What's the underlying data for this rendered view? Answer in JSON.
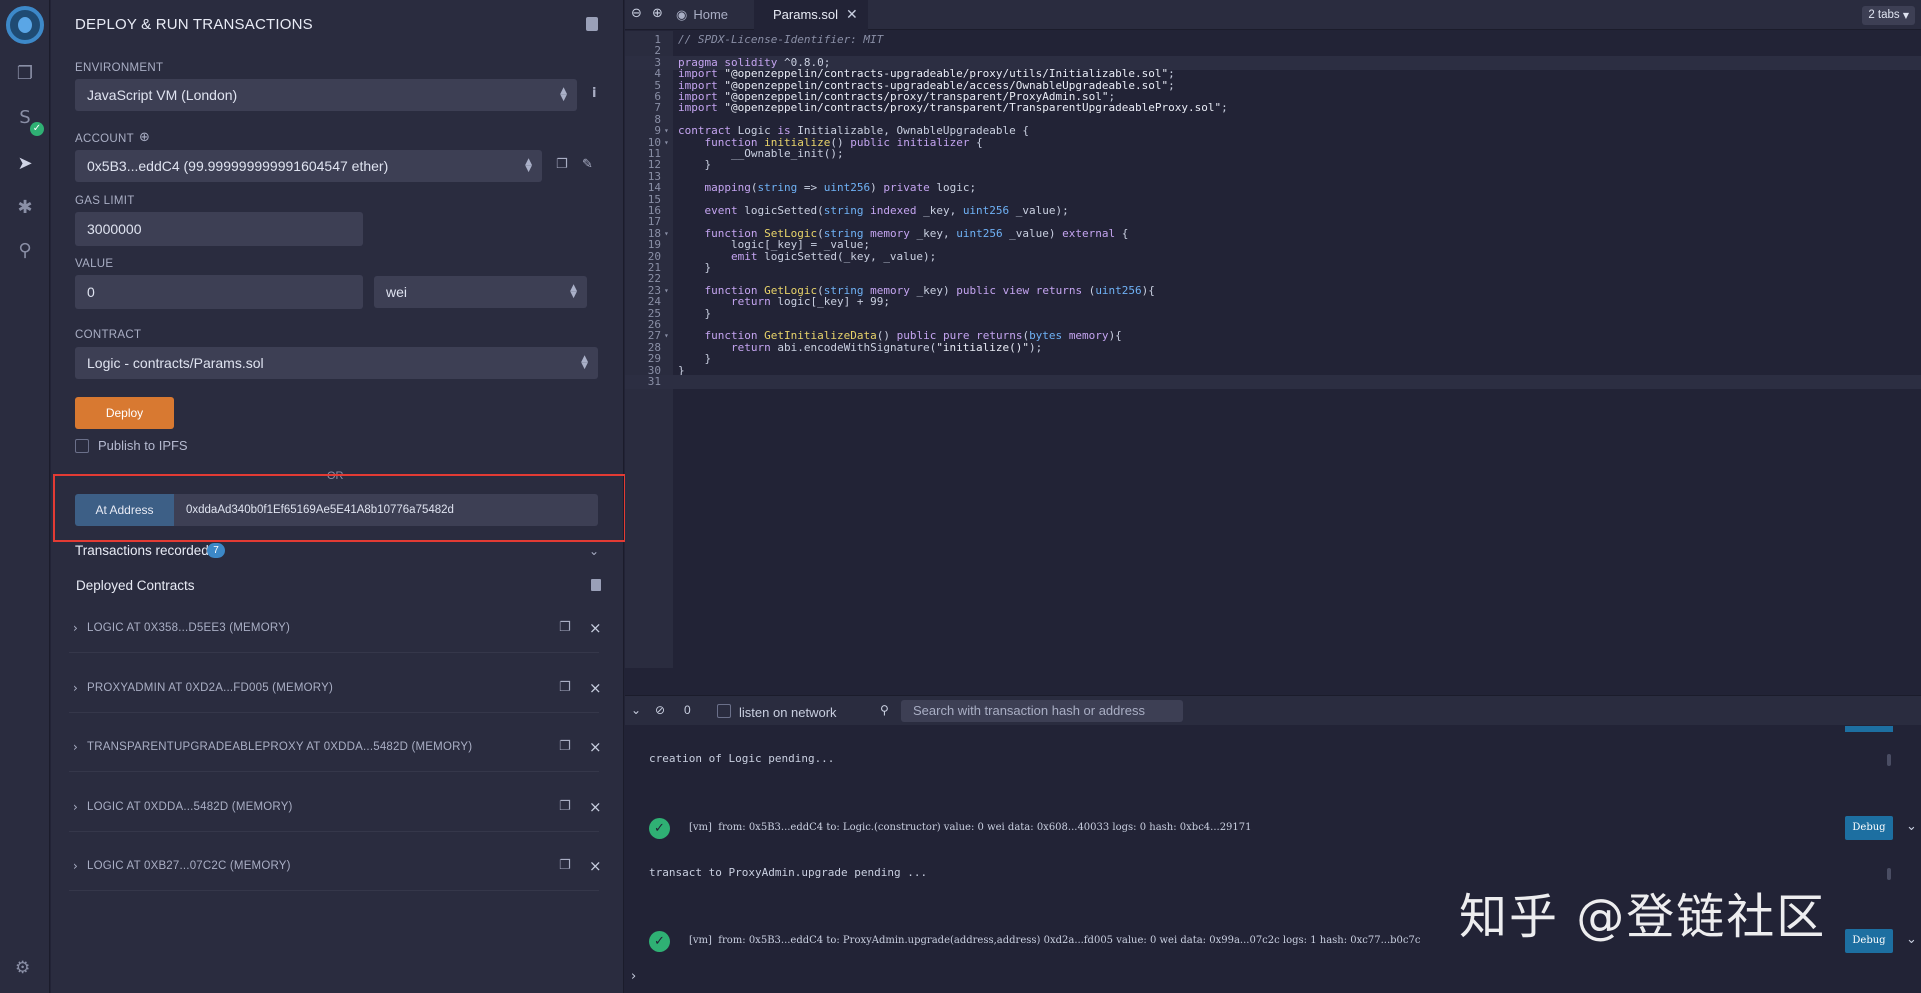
{
  "panel": {
    "title": "DEPLOY & RUN TRANSACTIONS",
    "environment_label": "ENVIRONMENT",
    "environment_value": "JavaScript VM (London)",
    "account_label": "ACCOUNT",
    "account_value": "0x5B3...eddC4 (99.999999999991604547 ether)",
    "gas_limit_label": "GAS LIMIT",
    "gas_limit_value": "3000000",
    "value_label": "VALUE",
    "value_amount": "0",
    "value_unit": "wei",
    "contract_label": "CONTRACT",
    "contract_value": "Logic - contracts/Params.sol",
    "deploy_label": "Deploy",
    "publish_label": "Publish to IPFS",
    "or_label": "OR",
    "at_address_label": "At Address",
    "at_address_value": "0xddaAd340b0f1Ef65169Ae5E41A8b10776a75482d",
    "transactions_recorded_label": "Transactions recorded",
    "transactions_recorded_count": "7",
    "deployed_contracts_label": "Deployed Contracts",
    "deployed_contracts": [
      {
        "name": "LOGIC AT 0X358...D5EE3 (MEMORY)"
      },
      {
        "name": "PROXYADMIN AT 0XD2A...FD005 (MEMORY)"
      },
      {
        "name": "TRANSPARENTUPGRADEABLEPROXY AT 0XDDA...5482D (MEMORY)"
      },
      {
        "name": "LOGIC AT 0XDDA...5482D (MEMORY)"
      },
      {
        "name": "LOGIC AT 0XB27...07C2C (MEMORY)"
      }
    ]
  },
  "tabs": {
    "home_label": "Home",
    "file_label": "Params.sol",
    "count_label": "2 tabs"
  },
  "terminal": {
    "count": "0",
    "listen_label": "listen on network",
    "search_placeholder": "Search with transaction hash or address",
    "line1": "creation of Logic pending...",
    "log1": "[vm]  from: 0x5B3...eddC4 to: Logic.(constructor) value: 0 wei data: 0x608...40033 logs: 0 hash: 0xbc4...29171",
    "line2": "transact to ProxyAdmin.upgrade pending ...",
    "log2": "[vm]  from: 0x5B3...eddC4 to: ProxyAdmin.upgrade(address,address) 0xd2a...fd005 value: 0 wei data: 0x99a...07c2c logs: 1 hash: 0xc77...b0c7c",
    "debug_label": "Debug"
  },
  "watermark": "知乎 @登链社区",
  "code_lines": [
    "// SPDX-License-Identifier: MIT",
    "",
    "pragma solidity ^0.8.0;",
    "import \"@openzeppelin/contracts-upgradeable/proxy/utils/Initializable.sol\";",
    "import \"@openzeppelin/contracts-upgradeable/access/OwnableUpgradeable.sol\";",
    "import \"@openzeppelin/contracts/proxy/transparent/ProxyAdmin.sol\";",
    "import \"@openzeppelin/contracts/proxy/transparent/TransparentUpgradeableProxy.sol\";",
    "",
    "contract Logic is Initializable, OwnableUpgradeable {",
    "    function initialize() public initializer {",
    "        __Ownable_init();",
    "    }",
    "",
    "    mapping(string => uint256) private logic;",
    "",
    "    event logicSetted(string indexed _key, uint256 _value);",
    "",
    "    function SetLogic(string memory _key, uint256 _value) external {",
    "        logic[_key] = _value;",
    "        emit logicSetted(_key, _value);",
    "    }",
    "",
    "    function GetLogic(string memory _key) public view returns (uint256){",
    "        return logic[_key] + 99;",
    "    }",
    "",
    "    function GetInitializeData() public pure returns(bytes memory){",
    "        return abi.encodeWithSignature(\"initialize()\");",
    "    }",
    "}",
    ""
  ],
  "fold_lines": [
    9,
    10,
    18,
    23,
    27
  ],
  "icons": {
    "rail": [
      "remix-logo-icon",
      "file-explorer-icon",
      "solidity-compiler-icon",
      "deploy-run-icon",
      "debugger-icon",
      "plugin-manager-icon",
      "settings-icon"
    ]
  },
  "colors": {
    "deploy_button": "#d87931",
    "at_address_button": "#3d5f86",
    "highlight_border": "#e33b34",
    "success": "#2fb074",
    "debug_button": "#1d6fa1"
  }
}
